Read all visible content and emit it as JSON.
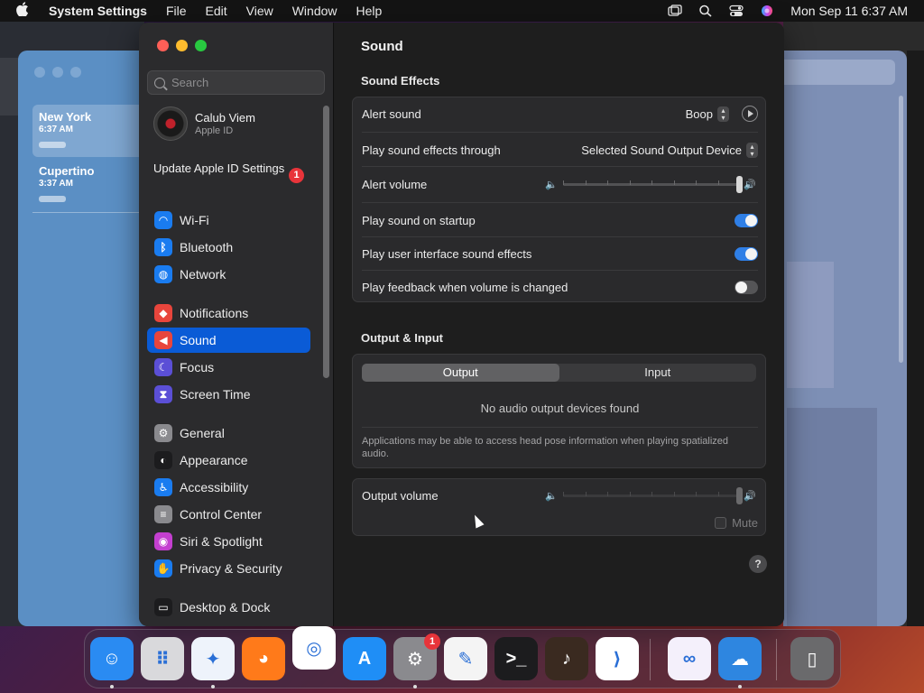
{
  "menubar": {
    "app_name": "System Settings",
    "items": [
      "File",
      "Edit",
      "View",
      "Window",
      "Help"
    ],
    "datetime": "Mon Sep 11  6:37 AM"
  },
  "clock_app": {
    "cities": [
      {
        "name": "New York",
        "time": "6:37 AM"
      },
      {
        "name": "Cupertino",
        "time": "3:37 AM"
      }
    ]
  },
  "sidebar": {
    "search_placeholder": "Search",
    "account_name": "Calub Viem",
    "account_sub": "Apple ID",
    "update_text": "Update Apple ID Settings",
    "update_badge": "1",
    "items": [
      {
        "label": "Wi-Fi",
        "icon": "wifi-icon",
        "color": "#1a7cf0"
      },
      {
        "label": "Bluetooth",
        "icon": "bluetooth-icon",
        "color": "#1a7cf0"
      },
      {
        "label": "Network",
        "icon": "globe-icon",
        "color": "#1a7cf0"
      },
      {
        "label": "Notifications",
        "icon": "bell-icon",
        "color": "#e8453c"
      },
      {
        "label": "Sound",
        "icon": "speaker-icon",
        "color": "#e8453c"
      },
      {
        "label": "Focus",
        "icon": "moon-icon",
        "color": "#5b4fd6"
      },
      {
        "label": "Screen Time",
        "icon": "hourglass-icon",
        "color": "#5b4fd6"
      },
      {
        "label": "General",
        "icon": "gear-icon",
        "color": "#8a8a8e"
      },
      {
        "label": "Appearance",
        "icon": "appearance-icon",
        "color": "#1c1c1e"
      },
      {
        "label": "Accessibility",
        "icon": "accessibility-icon",
        "color": "#1a7cf0"
      },
      {
        "label": "Control Center",
        "icon": "control-center-icon",
        "color": "#8a8a8e"
      },
      {
        "label": "Siri & Spotlight",
        "icon": "siri-icon",
        "color": "#c43fd0"
      },
      {
        "label": "Privacy & Security",
        "icon": "hand-icon",
        "color": "#1a7cf0"
      },
      {
        "label": "Desktop & Dock",
        "icon": "dock-icon",
        "color": "#1c1c1e"
      }
    ],
    "active": "Sound"
  },
  "content": {
    "title": "Sound",
    "effects_title": "Sound Effects",
    "alert_sound_label": "Alert sound",
    "alert_sound_value": "Boop",
    "play_through_label": "Play sound effects through",
    "play_through_value": "Selected Sound Output Device",
    "alert_volume_label": "Alert volume",
    "alert_volume_level": 1.0,
    "startup_label": "Play sound on startup",
    "startup_on": true,
    "ui_effects_label": "Play user interface sound effects",
    "ui_effects_on": true,
    "feedback_label": "Play feedback when volume is changed",
    "feedback_on": false,
    "output_input_title": "Output & Input",
    "tab_output": "Output",
    "tab_input": "Input",
    "no_devices": "No audio output devices found",
    "note": "Applications may be able to access head pose information when playing spatialized audio.",
    "output_volume_label": "Output volume",
    "output_volume_level": 1.0,
    "mute_label": "Mute",
    "help": "?"
  },
  "dock": {
    "apps": [
      {
        "name": "finder",
        "color": "#2a8bf2"
      },
      {
        "name": "launchpad",
        "color": "#d9d9dc"
      },
      {
        "name": "safari",
        "color": "#eef3fb"
      },
      {
        "name": "firefox",
        "color": "#ff7a1a"
      },
      {
        "name": "chrome",
        "color": "#ffffff"
      },
      {
        "name": "app-store",
        "color": "#1f8ef6"
      },
      {
        "name": "system-settings",
        "color": "#8a8a8e"
      },
      {
        "name": "textedit",
        "color": "#f4f4f4"
      },
      {
        "name": "terminal",
        "color": "#1c1c1e"
      },
      {
        "name": "garageband",
        "color": "#3a2a20"
      },
      {
        "name": "vscode",
        "color": "#ffffff"
      },
      {
        "name": "visual-studio",
        "color": "#f4f0fb"
      },
      {
        "name": "weather",
        "color": "#2e86e0"
      },
      {
        "name": "trash",
        "color": "#6a6a6c"
      }
    ],
    "settings_badge": "1"
  },
  "icons": {
    "alert_volume_low": "🔈",
    "alert_volume_high": "🔊"
  }
}
